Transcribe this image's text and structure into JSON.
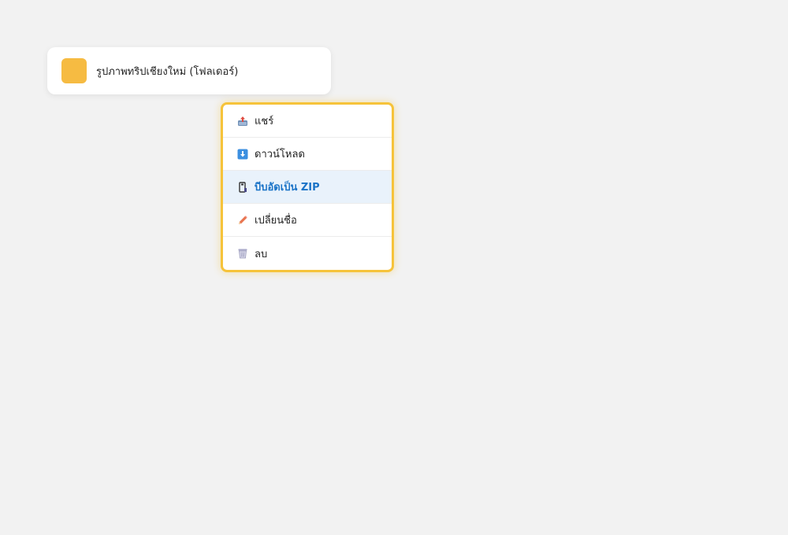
{
  "folder": {
    "name": "รูปภาพทริปเชียงใหม่ (โฟลเดอร์)",
    "color": "#f6bb42"
  },
  "menu": {
    "border_color": "#f6c33a",
    "active_color": "#1a73c7",
    "items": [
      {
        "label": "แชร์",
        "icon": "share-icon"
      },
      {
        "label": "ดาวน์โหลด",
        "icon": "download-icon"
      },
      {
        "label": "บีบอัดเป็น ZIP",
        "icon": "zip-icon",
        "active": true
      },
      {
        "label": "เปลี่ยนชื่อ",
        "icon": "rename-icon"
      },
      {
        "label": "ลบ",
        "icon": "trash-icon"
      }
    ]
  }
}
